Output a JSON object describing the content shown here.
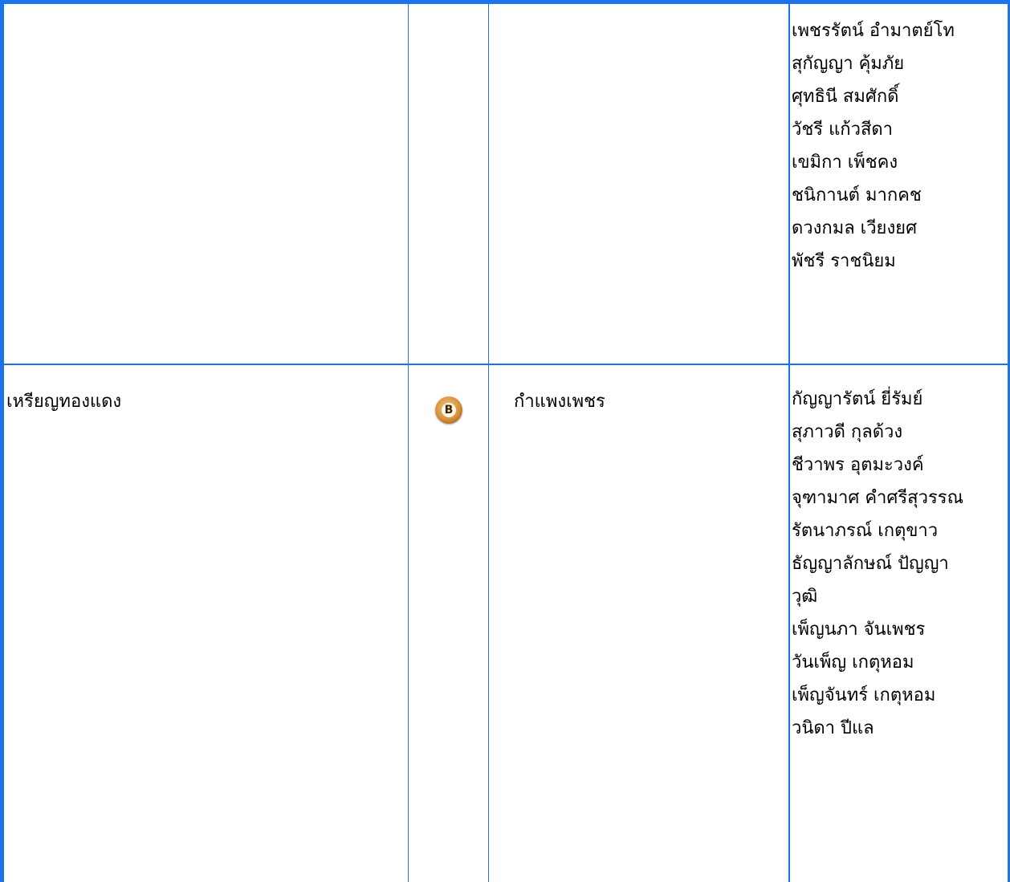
{
  "colors": {
    "grid": "#1a73e8",
    "badge": "#d7913a"
  },
  "rows": [
    {
      "medal": "",
      "province": "",
      "names": [
        "เพชรรัตน์  อำมาตย์โท",
        "สุกัญญา  คุ้มภัย",
        "ศุทธินี  สมศักดิ์",
        "วัชรี  แก้วสีดา",
        "เขมิกา  เพ็ชคง",
        "ชนิกานต์  มากคช",
        "ดวงกมล  เวียงยศ",
        "พัชรี  ราชนิยม"
      ]
    },
    {
      "medal": "เหรียญทองแดง",
      "badge_icon": "bronze-medal-icon",
      "badge_letter": "B",
      "province": "กำแพงเพชร",
      "names": [
        "กัญญารัตน์  ยี่รัมย์",
        "สุภาวดี  กุลด้วง",
        "ชีวาพร  อุตมะวงค์",
        "จุฑามาศ  คำศรีสุวรรณ",
        "รัตนาภรณ์  เกตุขาว",
        "ธัญญาลักษณ์  ปัญญา",
        "วุฒิ",
        "เพ็ญนภา  จันเพชร",
        "วันเพ็ญ  เกตุหอม",
        "เพ็ญจันทร์  เกตุหอม",
        "วนิดา  ปีแล"
      ]
    }
  ]
}
